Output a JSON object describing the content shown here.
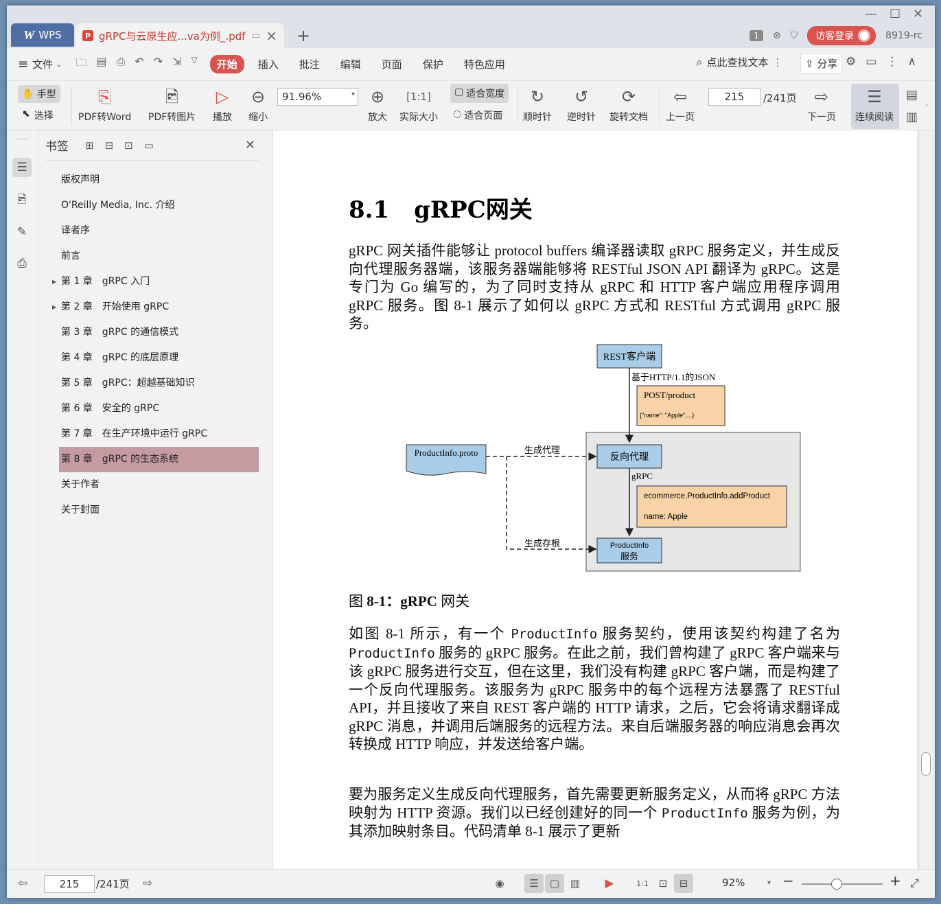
{
  "titlebar": {
    "app_tab": "WPS",
    "doc_tab": "gRPC与云原生应...va为例_.pdf",
    "tab_count": "1",
    "login": "访客登录",
    "user_id": "8919-rc"
  },
  "menubar": {
    "file": "文件",
    "items": [
      "开始",
      "插入",
      "批注",
      "编辑",
      "页面",
      "保护",
      "特色应用"
    ],
    "search": "点此查找文本",
    "share": "分享"
  },
  "toolbar": {
    "hand": "手型",
    "select": "选择",
    "pdf_to_word": "PDF转Word",
    "pdf_to_image": "PDF转图片",
    "play": "播放",
    "zoom_out": "缩小",
    "zoom_value": "91.96%",
    "zoom_in": "放大",
    "actual_size": "实际大小",
    "fit_width": "适合宽度",
    "fit_page": "适合页面",
    "clockwise": "顺时针",
    "counter_clockwise": "逆时针",
    "rotate_doc": "旋转文档",
    "prev_page": "上一页",
    "page_current": "215",
    "page_total": "/241页",
    "next_page": "下一页",
    "continuous": "连续阅读"
  },
  "bookmarks": {
    "title": "书签",
    "items": [
      {
        "label": "版权声明"
      },
      {
        "label": "O'Reilly Media, Inc. 介绍"
      },
      {
        "label": "译者序"
      },
      {
        "label": "前言"
      },
      {
        "label": "第 1 章　gRPC 入门"
      },
      {
        "label": "第 2 章　开始使用 gRPC"
      },
      {
        "label": "第 3 章　gRPC 的通信模式"
      },
      {
        "label": "第 4 章　gRPC 的底层原理"
      },
      {
        "label": "第 5 章　gRPC：超越基础知识"
      },
      {
        "label": "第 6 章　安全的 gRPC"
      },
      {
        "label": "第 7 章　在生产环境中运行 gRPC"
      },
      {
        "label": "第 8 章　gRPC 的生态系统"
      },
      {
        "label": "关于作者"
      },
      {
        "label": "关于封面"
      }
    ]
  },
  "page": {
    "heading_num": "8.1",
    "heading_text": "gRPC网关",
    "para1": "gRPC 网关插件能够让 protocol buffers 编译器读取 gRPC 服务定义，并生成反向代理服务器端，该服务器端能够将 RESTful JSON API 翻译为 gRPC。这是专门为 Go 编写的，为了同时支持从 gRPC 和 HTTP 客户端应用程序调用 gRPC 服务。图 8-1 展示了如何以 gRPC 方式和 RESTful 方式调用 gRPC 服务。",
    "figure": {
      "rest_client": "REST客户端",
      "http_json": "基于HTTP/1.1的JSON",
      "post_product": "POST/product",
      "post_body": "{\"name\": \"Apple\",...}",
      "proto_file": "ProductInfo.proto",
      "gen_proxy": "生成代理",
      "reverse_proxy": "反向代理",
      "grpc": "gRPC",
      "method": "ecommerce.ProductInfo.addProduct",
      "name_apple": "name: Apple",
      "gen_stub": "生成存根",
      "service_1": "ProductInfo",
      "service_2": "服务"
    },
    "caption_prefix": "图 ",
    "caption_bold": "8-1：gRPC",
    "caption_suffix": " 网关",
    "para2_a": "如图 8-1 所示，有一个 ",
    "para2_code1": "ProductInfo",
    "para2_b": " 服务契约，使用该契约构建了名为 ",
    "para2_code2": "ProductInfo",
    "para2_c": " 服务的 gRPC 服务。在此之前，我们曾构建了 gRPC 客户端来与该 gRPC 服务进行交互，但在这里，我们没有构建 gRPC 客户端，而是构建了一个反向代理服务。该服务为 gRPC 服务中的每个远程方法暴露了 RESTful API，并且接收了来自 REST 客户端的 HTTP 请求，之后，它会将请求翻译成 gRPC 消息，并调用后端服务的远程方法。来自后端服务器的响应消息会再次转换成 HTTP 响应，并发送给客户端。",
    "para3_a": "要为服务定义生成反向代理服务，首先需要更新服务定义，从而将 gRPC 方法映射为 HTTP 资源。我们以已经创建好的同一个 ",
    "para3_code": "ProductInfo",
    "para3_b": " 服务为例，为其添加映射条目。代码清单 8-1 展示了更新"
  },
  "statusbar": {
    "page_current": "215",
    "page_total": "/241页",
    "zoom": "92%"
  },
  "colors": {
    "accent": "#d9534f",
    "bookmark_active": "#c59aa1",
    "box_blue": "#a9cde8",
    "box_orange": "#f9d3a8"
  }
}
